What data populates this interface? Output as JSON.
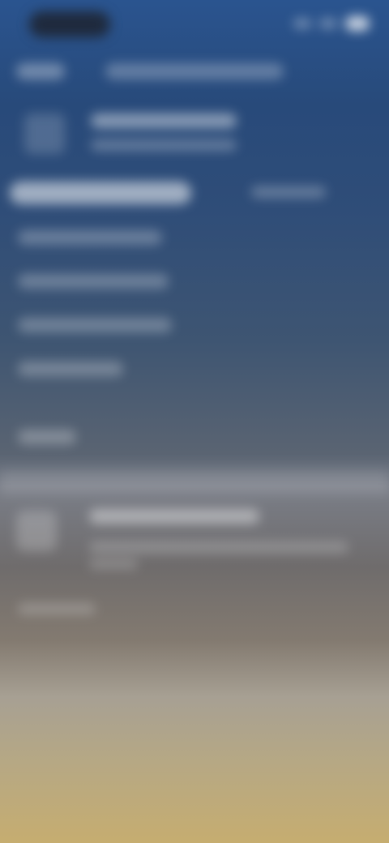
{
  "screen": {
    "status_bar": {
      "pill_text": ""
    },
    "navigation": {
      "back_label": "",
      "title": ""
    },
    "header_card": {
      "title": "",
      "subtitle": ""
    },
    "tabs": [
      {
        "label": ""
      },
      {
        "label": ""
      }
    ],
    "list_items": [
      {
        "label": ""
      },
      {
        "label": ""
      },
      {
        "label": ""
      },
      {
        "label": ""
      },
      {
        "label": ""
      }
    ],
    "bottom_card": {
      "title": "",
      "subtitle": "",
      "footer": ""
    }
  }
}
